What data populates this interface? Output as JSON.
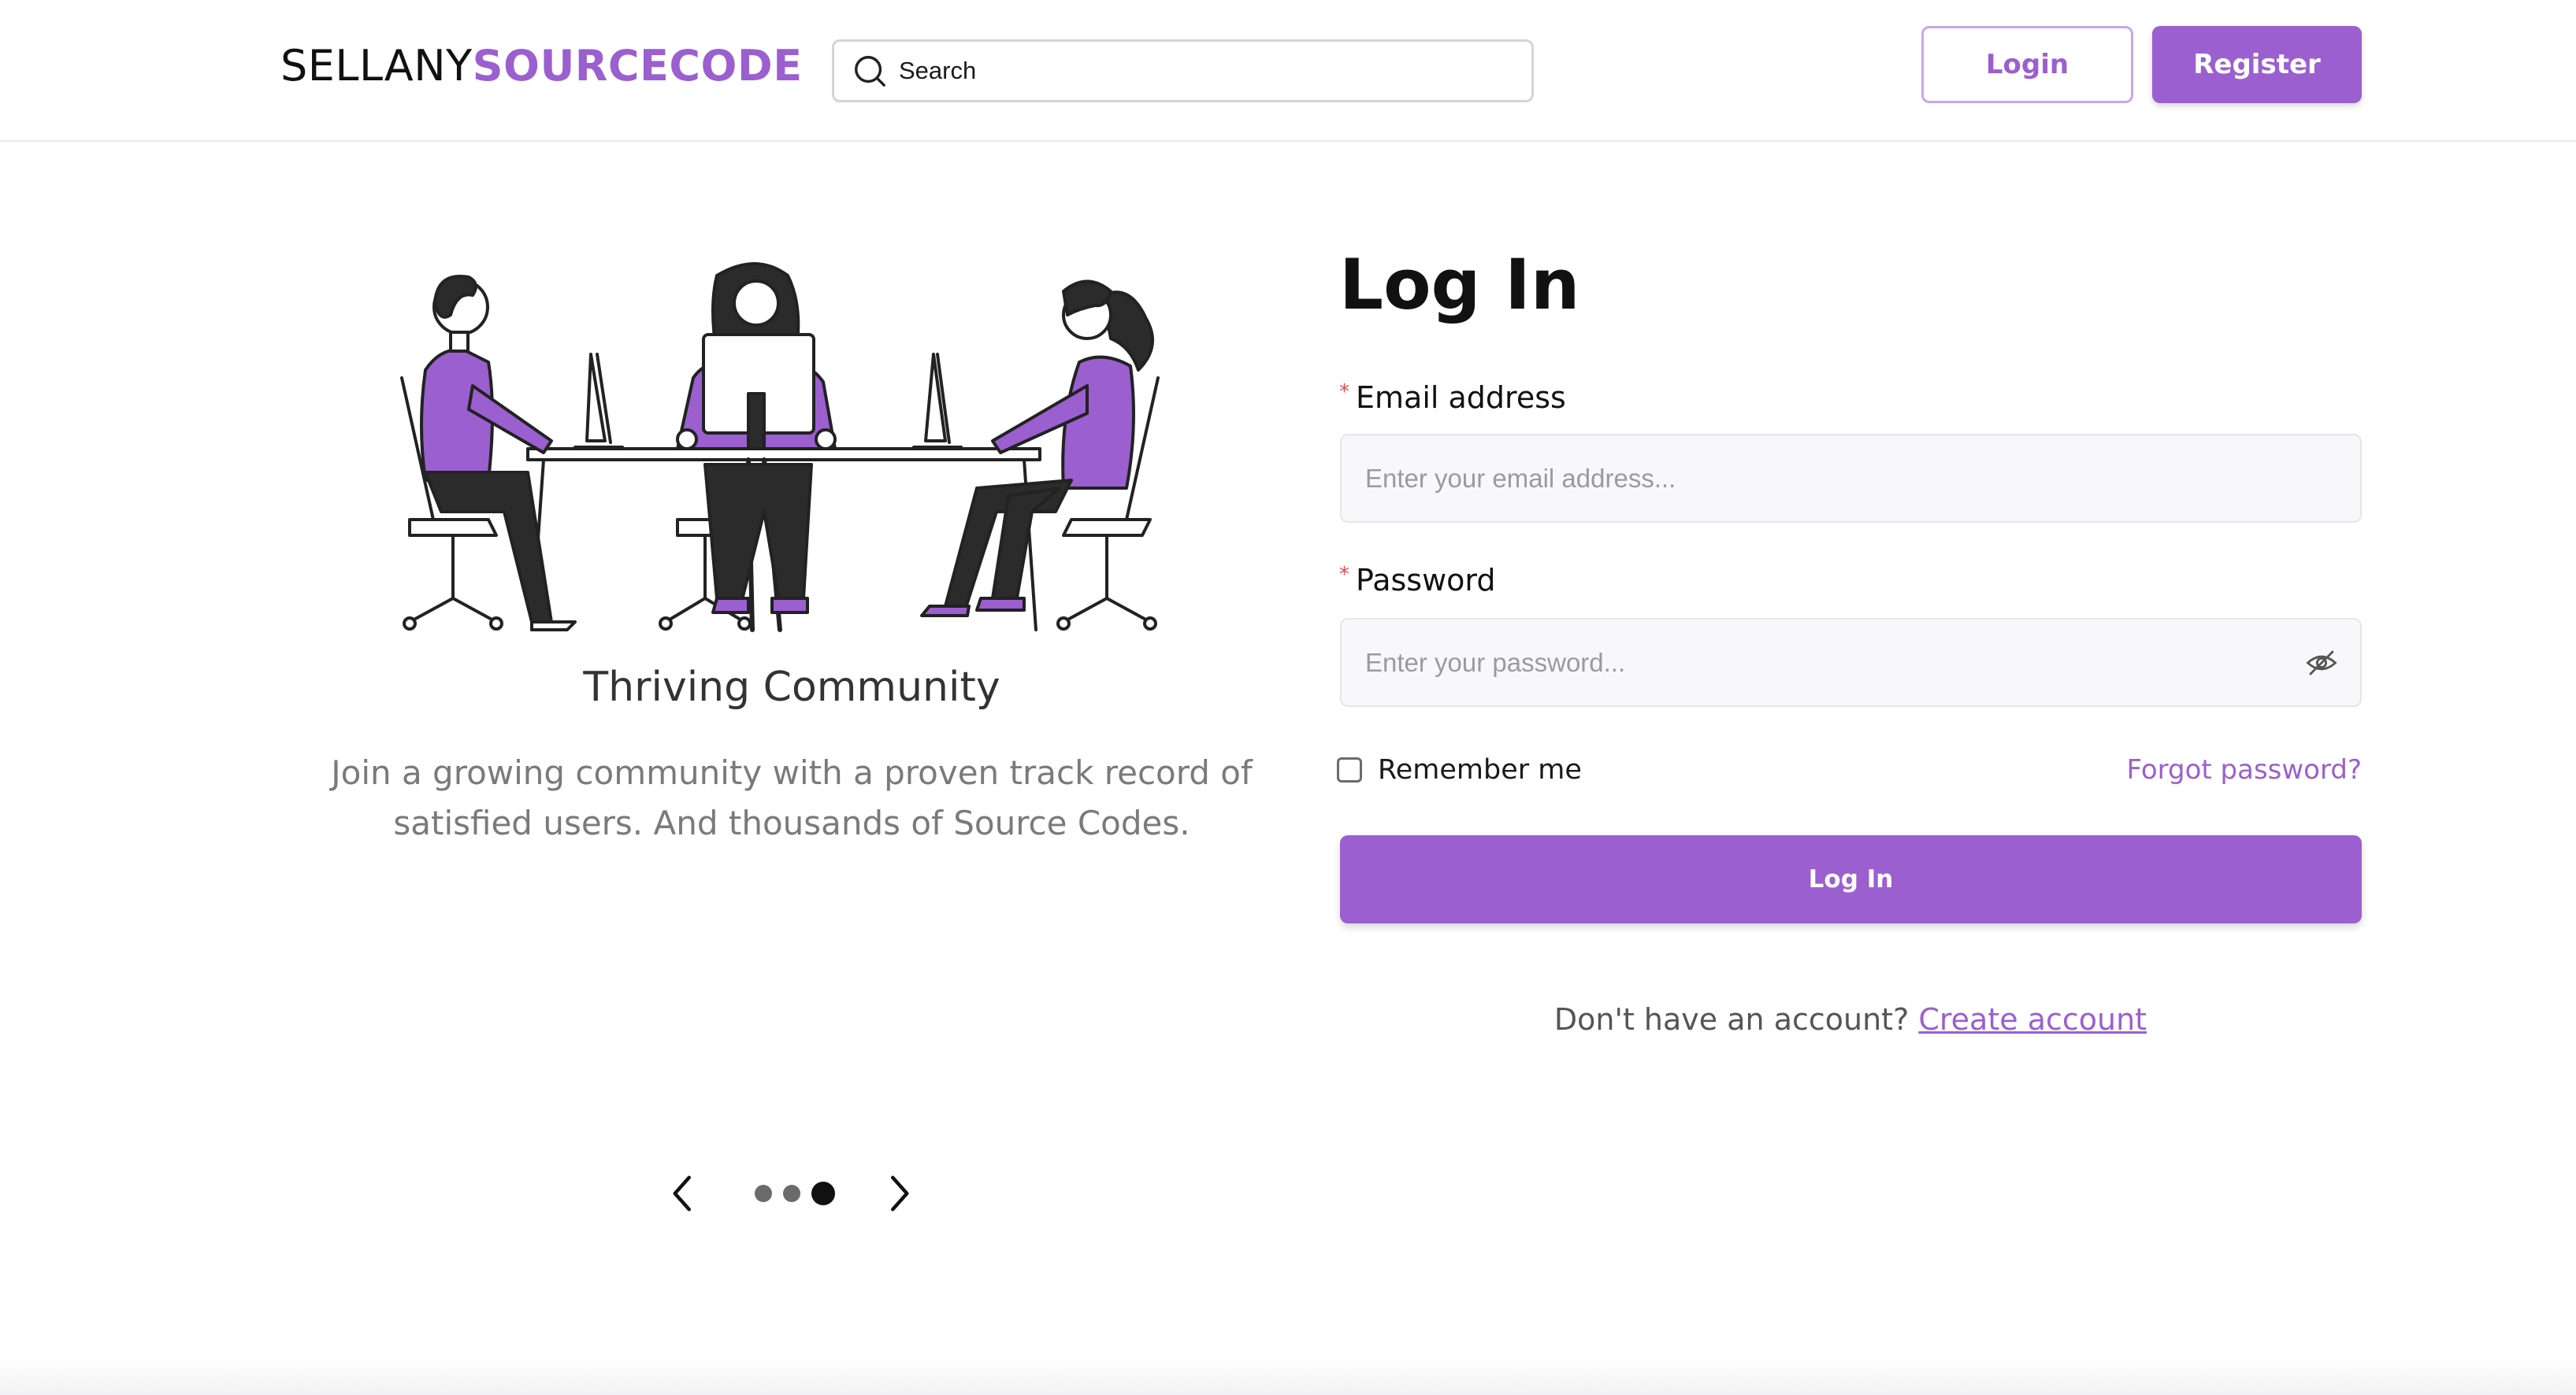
{
  "header": {
    "logo_part1": "SELLANY",
    "logo_part2": "SOURCECODE",
    "search_placeholder": "Search",
    "login_label": "Login",
    "register_label": "Register"
  },
  "carousel": {
    "slide_title": "Thriving Community",
    "slide_description": "Join a growing community with a proven track record of satisfied users. And thousands of Source Codes.",
    "current_slide": 3,
    "total_slides": 3
  },
  "form": {
    "title": "Log In",
    "email_label": "Email address",
    "email_placeholder": "Enter your email address...",
    "password_label": "Password",
    "password_placeholder": "Enter your password...",
    "remember_label": "Remember me",
    "remember_checked": false,
    "forgot_label": "Forgot password?",
    "submit_label": "Log In",
    "signup_prompt": "Don't have an account?",
    "signup_link": "Create account"
  },
  "colors": {
    "accent": "#9b5fd0",
    "text": "#111111",
    "muted": "#7a7a7a"
  },
  "icons": {
    "search": "search-icon",
    "eye": "eye-off-icon",
    "prev": "chevron-left-icon",
    "next": "chevron-right-icon"
  }
}
